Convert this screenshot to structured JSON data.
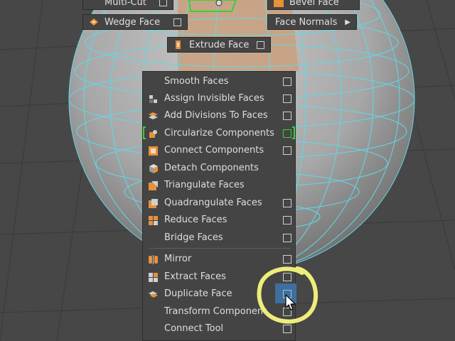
{
  "top_menu": {
    "multi_cut_label": "Multi-Cut",
    "bevel_face_label": "Bevel Face",
    "wedge_face_label": "Wedge Face",
    "face_normals_label": "Face Normals",
    "extrude_face_label": "Extrude Face"
  },
  "menu": {
    "items": [
      {
        "label": "Smooth Faces",
        "icon": "none",
        "option_box": true
      },
      {
        "label": "Assign Invisible Faces",
        "icon": "invisible-faces-icon",
        "option_box": true
      },
      {
        "label": "Add Divisions To Faces",
        "icon": "add-divisions-icon",
        "option_box": true
      },
      {
        "label": "Circularize Components",
        "icon": "circularize-icon",
        "option_box": true
      },
      {
        "label": "Connect Components",
        "icon": "connect-components-icon",
        "option_box": true
      },
      {
        "label": "Detach Components",
        "icon": "detach-components-icon",
        "option_box": false
      },
      {
        "label": "Triangulate Faces",
        "icon": "triangulate-icon",
        "option_box": false
      },
      {
        "label": "Quadrangulate Faces",
        "icon": "quadrangulate-icon",
        "option_box": true
      },
      {
        "label": "Reduce Faces",
        "icon": "reduce-faces-icon",
        "option_box": true
      },
      {
        "label": "Bridge Faces",
        "icon": "none",
        "option_box": true
      },
      {
        "label": "Mirror",
        "icon": "mirror-icon",
        "option_box": true
      },
      {
        "label": "Extract Faces",
        "icon": "extract-faces-icon",
        "option_box": true
      },
      {
        "label": "Duplicate Face",
        "icon": "duplicate-face-icon",
        "option_box": true
      },
      {
        "label": "Transform Component",
        "icon": "none",
        "option_box": true
      },
      {
        "label": "Connect Tool",
        "icon": "none",
        "option_box": true
      }
    ]
  },
  "colors": {
    "wireframe": "#5fd9e8",
    "highlight_green": "#36d336",
    "selection_blue": "#3f6f9c",
    "annotation_yellow": "#eded7a",
    "icon_orange": "#e8903a"
  }
}
